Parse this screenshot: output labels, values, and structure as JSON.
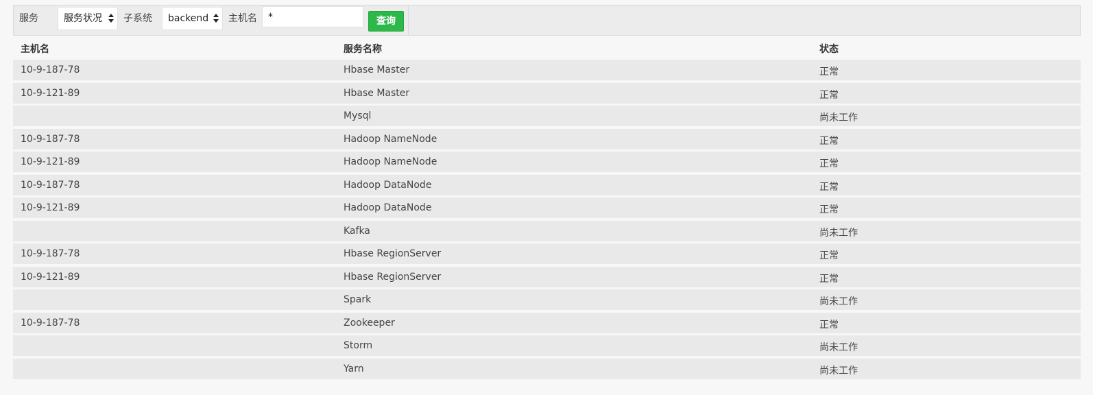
{
  "filters": {
    "service_label": "服务",
    "service_select_value": "服务状况",
    "subsystem_label": "子系统",
    "subsystem_select_value": "backend",
    "hostname_label": "主机名",
    "hostname_input_value": "*",
    "query_button_label": "查询"
  },
  "table": {
    "headers": [
      "主机名",
      "服务名称",
      "状态"
    ],
    "rows": [
      {
        "host": "10-9-187-78",
        "service": "Hbase Master",
        "status": "正常"
      },
      {
        "host": "10-9-121-89",
        "service": "Hbase Master",
        "status": "正常"
      },
      {
        "host": "",
        "service": "Mysql",
        "status": "尚未工作"
      },
      {
        "host": "10-9-187-78",
        "service": "Hadoop NameNode",
        "status": "正常"
      },
      {
        "host": "10-9-121-89",
        "service": "Hadoop NameNode",
        "status": "正常"
      },
      {
        "host": "10-9-187-78",
        "service": "Hadoop DataNode",
        "status": "正常"
      },
      {
        "host": "10-9-121-89",
        "service": "Hadoop DataNode",
        "status": "正常"
      },
      {
        "host": "",
        "service": "Kafka",
        "status": "尚未工作"
      },
      {
        "host": "10-9-187-78",
        "service": "Hbase RegionServer",
        "status": "正常"
      },
      {
        "host": "10-9-121-89",
        "service": "Hbase RegionServer",
        "status": "正常"
      },
      {
        "host": "",
        "service": "Spark",
        "status": "尚未工作"
      },
      {
        "host": "10-9-187-78",
        "service": "Zookeeper",
        "status": "正常"
      },
      {
        "host": "",
        "service": "Storm",
        "status": "尚未工作"
      },
      {
        "host": "",
        "service": "Yarn",
        "status": "尚未工作"
      }
    ]
  },
  "colors": {
    "query_button": "#2db84a",
    "row_background": "#e9e9e9",
    "page_background": "#f7f7f7"
  }
}
